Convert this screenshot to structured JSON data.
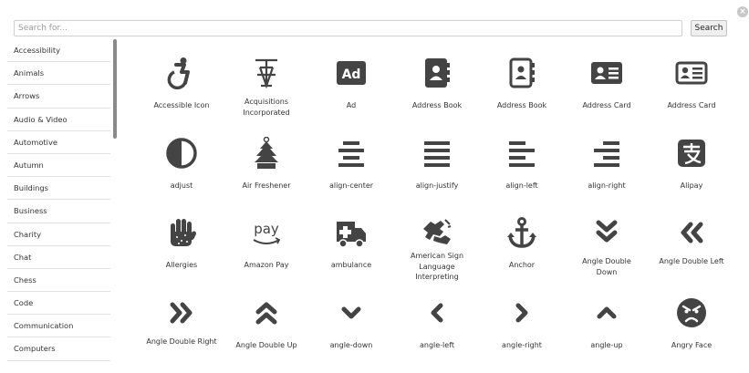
{
  "close": {
    "glyph": "×",
    "icon": "close-icon"
  },
  "search": {
    "placeholder": "Search for...",
    "value": "",
    "button_label": "Search"
  },
  "categories": [
    "Accessibility",
    "Animals",
    "Arrows",
    "Audio & Video",
    "Automotive",
    "Autumn",
    "Buildings",
    "Business",
    "Charity",
    "Chat",
    "Chess",
    "Code",
    "Communication",
    "Computers"
  ],
  "icons": [
    {
      "label": "Accessible Icon",
      "icon": "wheelchair-icon"
    },
    {
      "label": "Acquisitions Incorporated",
      "icon": "acquisitions-incorporated-icon"
    },
    {
      "label": "Ad",
      "icon": "ad-icon"
    },
    {
      "label": "Address Book",
      "icon": "address-book-solid-icon"
    },
    {
      "label": "Address Book",
      "icon": "address-book-outline-icon"
    },
    {
      "label": "Address Card",
      "icon": "address-card-solid-icon"
    },
    {
      "label": "Address Card",
      "icon": "address-card-outline-icon"
    },
    {
      "label": "adjust",
      "icon": "adjust-icon"
    },
    {
      "label": "Air Freshener",
      "icon": "air-freshener-icon"
    },
    {
      "label": "align-center",
      "icon": "align-center-icon"
    },
    {
      "label": "align-justify",
      "icon": "align-justify-icon"
    },
    {
      "label": "align-left",
      "icon": "align-left-icon"
    },
    {
      "label": "align-right",
      "icon": "align-right-icon"
    },
    {
      "label": "Alipay",
      "icon": "alipay-icon"
    },
    {
      "label": "Allergies",
      "icon": "allergies-icon"
    },
    {
      "label": "Amazon Pay",
      "icon": "amazon-pay-icon"
    },
    {
      "label": "ambulance",
      "icon": "ambulance-icon"
    },
    {
      "label": "American Sign Language Interpreting",
      "icon": "sign-language-icon"
    },
    {
      "label": "Anchor",
      "icon": "anchor-icon"
    },
    {
      "label": "Angle Double Down",
      "icon": "angle-double-down-icon"
    },
    {
      "label": "Angle Double Left",
      "icon": "angle-double-left-icon"
    },
    {
      "label": "Angle Double Right",
      "icon": "angle-double-right-icon"
    },
    {
      "label": "Angle Double Up",
      "icon": "angle-double-up-icon"
    },
    {
      "label": "angle-down",
      "icon": "angle-down-icon"
    },
    {
      "label": "angle-left",
      "icon": "angle-left-icon"
    },
    {
      "label": "angle-right",
      "icon": "angle-right-icon"
    },
    {
      "label": "angle-up",
      "icon": "angle-up-icon"
    },
    {
      "label": "Angry Face",
      "icon": "angry-face-icon"
    }
  ],
  "colors": {
    "icon": "#444444",
    "text": "#333333",
    "border": "#e3e3e3",
    "scrollbar": "#8a8a8a"
  }
}
